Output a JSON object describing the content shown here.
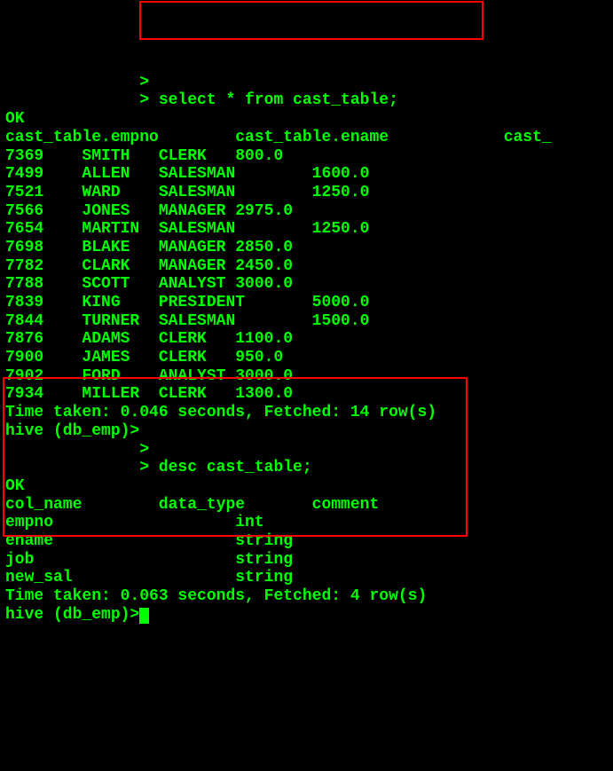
{
  "prompt_indent": "              ",
  "prompt_symbol": "> ",
  "query1": "select * from cast_table;",
  "ok": "OK",
  "header": {
    "col1": "cast_table.empno",
    "col2": "cast_table.ename",
    "col3": "cast_"
  },
  "rows": [
    {
      "c1": "7369",
      "c2": "SMITH",
      "c3": "CLERK",
      "c4": "800.0"
    },
    {
      "c1": "7499",
      "c2": "ALLEN",
      "c3": "SALESMAN",
      "c4": "1600.0"
    },
    {
      "c1": "7521",
      "c2": "WARD",
      "c3": "SALESMAN",
      "c4": "1250.0"
    },
    {
      "c1": "7566",
      "c2": "JONES",
      "c3": "MANAGER",
      "c4": "2975.0"
    },
    {
      "c1": "7654",
      "c2": "MARTIN",
      "c3": "SALESMAN",
      "c4": "1250.0"
    },
    {
      "c1": "7698",
      "c2": "BLAKE",
      "c3": "MANAGER",
      "c4": "2850.0"
    },
    {
      "c1": "7782",
      "c2": "CLARK",
      "c3": "MANAGER",
      "c4": "2450.0"
    },
    {
      "c1": "7788",
      "c2": "SCOTT",
      "c3": "ANALYST",
      "c4": "3000.0"
    },
    {
      "c1": "7839",
      "c2": "KING",
      "c3": "PRESIDENT",
      "c4": "5000.0"
    },
    {
      "c1": "7844",
      "c2": "TURNER",
      "c3": "SALESMAN",
      "c4": "1500.0"
    },
    {
      "c1": "7876",
      "c2": "ADAMS",
      "c3": "CLERK",
      "c4": "1100.0"
    },
    {
      "c1": "7900",
      "c2": "JAMES",
      "c3": "CLERK",
      "c4": "950.0"
    },
    {
      "c1": "7902",
      "c2": "FORD",
      "c3": "ANALYST",
      "c4": "3000.0"
    },
    {
      "c1": "7934",
      "c2": "MILLER",
      "c3": "CLERK",
      "c4": "1300.0"
    }
  ],
  "timing1": "Time taken: 0.046 seconds, Fetched: 14 row(s)",
  "hive_prompt": "hive (db_emp)>",
  "query2": "desc cast_table;",
  "desc_header": {
    "c1": "col_name",
    "c2": "data_type",
    "c3": "comment"
  },
  "desc_rows": [
    {
      "name": "empno",
      "type": "int"
    },
    {
      "name": "ename",
      "type": "string"
    },
    {
      "name": "job",
      "type": "string"
    },
    {
      "name": "new_sal",
      "type": "string"
    }
  ],
  "timing2": "Time taken: 0.063 seconds, Fetched: 4 row(s)"
}
